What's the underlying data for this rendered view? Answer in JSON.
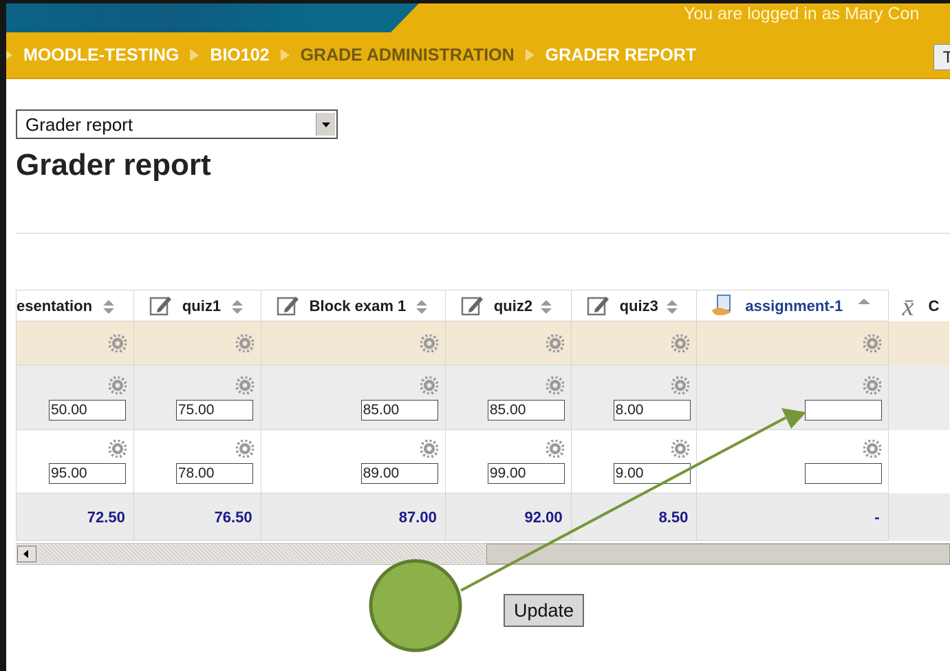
{
  "header": {
    "login_text": "You are logged in as Mary Con",
    "turn_editing_partial": "T"
  },
  "breadcrumb": [
    "MOODLE-TESTING",
    "BIO102",
    "GRADE ADMINISTRATION",
    "GRADER REPORT"
  ],
  "report_selector": {
    "value": "Grader report"
  },
  "page_title": "Grader report",
  "grid": {
    "columns": [
      {
        "label": "esentation",
        "type": "edit-item",
        "sort": "both"
      },
      {
        "label": "quiz1",
        "type": "edit-item",
        "sort": "both"
      },
      {
        "label": "Block exam 1",
        "type": "edit-item",
        "sort": "both"
      },
      {
        "label": "quiz2",
        "type": "edit-item",
        "sort": "both"
      },
      {
        "label": "quiz3",
        "type": "edit-item",
        "sort": "both"
      },
      {
        "label": "assignment-1",
        "type": "assignment",
        "sort": "asc"
      },
      {
        "label": "C",
        "type": "category-total",
        "sort": ""
      }
    ],
    "rows": [
      [
        "50.00",
        "75.00",
        "85.00",
        "85.00",
        "8.00",
        ""
      ],
      [
        "95.00",
        "78.00",
        "89.00",
        "99.00",
        "9.00",
        ""
      ]
    ],
    "averages": [
      "72.50",
      "76.50",
      "87.00",
      "92.00",
      "8.50",
      "-"
    ]
  },
  "update_button": "Update",
  "colors": {
    "header_bar": "#e8b00c",
    "breadcrumb_active": "#ffffff",
    "breadcrumb_dim": "#6e5a16",
    "range_row": "#f2e8d4",
    "average_text": "#1a1a8c",
    "annotation": "#7a9a3b"
  }
}
